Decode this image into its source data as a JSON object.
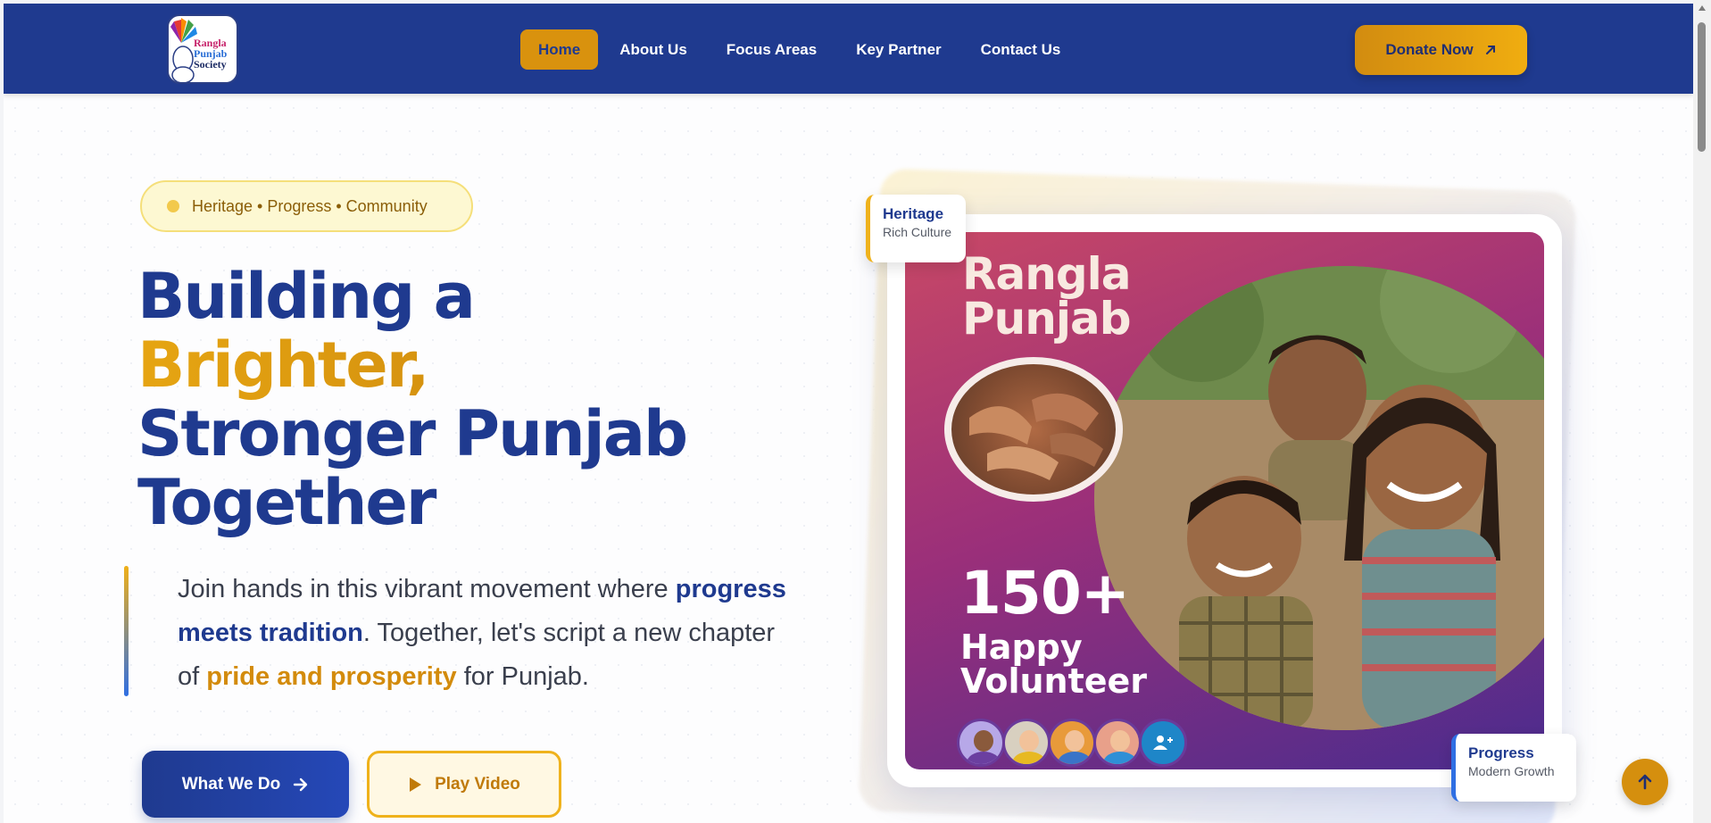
{
  "header": {
    "logo_text": [
      "Rangla",
      "Punjab",
      "Society"
    ],
    "nav": [
      {
        "label": "Home",
        "active": true
      },
      {
        "label": "About Us"
      },
      {
        "label": "Focus Areas"
      },
      {
        "label": "Key Partner"
      },
      {
        "label": "Contact Us"
      }
    ],
    "donate_label": "Donate Now",
    "donate_icon": "arrow-up-right-icon",
    "bg_color": "#1f3a8f",
    "accent_color": "#d9920e"
  },
  "hero": {
    "tagline": "Heritage • Progress • Community",
    "headline": {
      "line1": "Building a",
      "line2": "Brighter,",
      "line3": "Stronger Punjab",
      "line4": "Together"
    },
    "description": {
      "part1": "Join hands in this vibrant movement where",
      "highlight1": "progress meets tradition",
      "part2": ". Together, let's script a new chapter of",
      "highlight2": "pride and prosperity",
      "part3": " for Punjab."
    },
    "buttons": {
      "primary": "What We Do",
      "primary_icon": "arrow-right-icon",
      "secondary": "Play Video",
      "secondary_icon": "play-icon"
    }
  },
  "visual": {
    "poster_title": [
      "Rangla",
      "Punjab"
    ],
    "stat_number": "150+",
    "stat_label": [
      "Happy",
      "Volunteer"
    ],
    "avatar_add_icon": "user-plus-icon",
    "badge_heritage": {
      "title": "Heritage",
      "subtitle": "Rich Culture"
    },
    "badge_progress": {
      "title": "Progress",
      "subtitle": "Modern Growth"
    }
  },
  "scroll_top_icon": "arrow-up-icon"
}
